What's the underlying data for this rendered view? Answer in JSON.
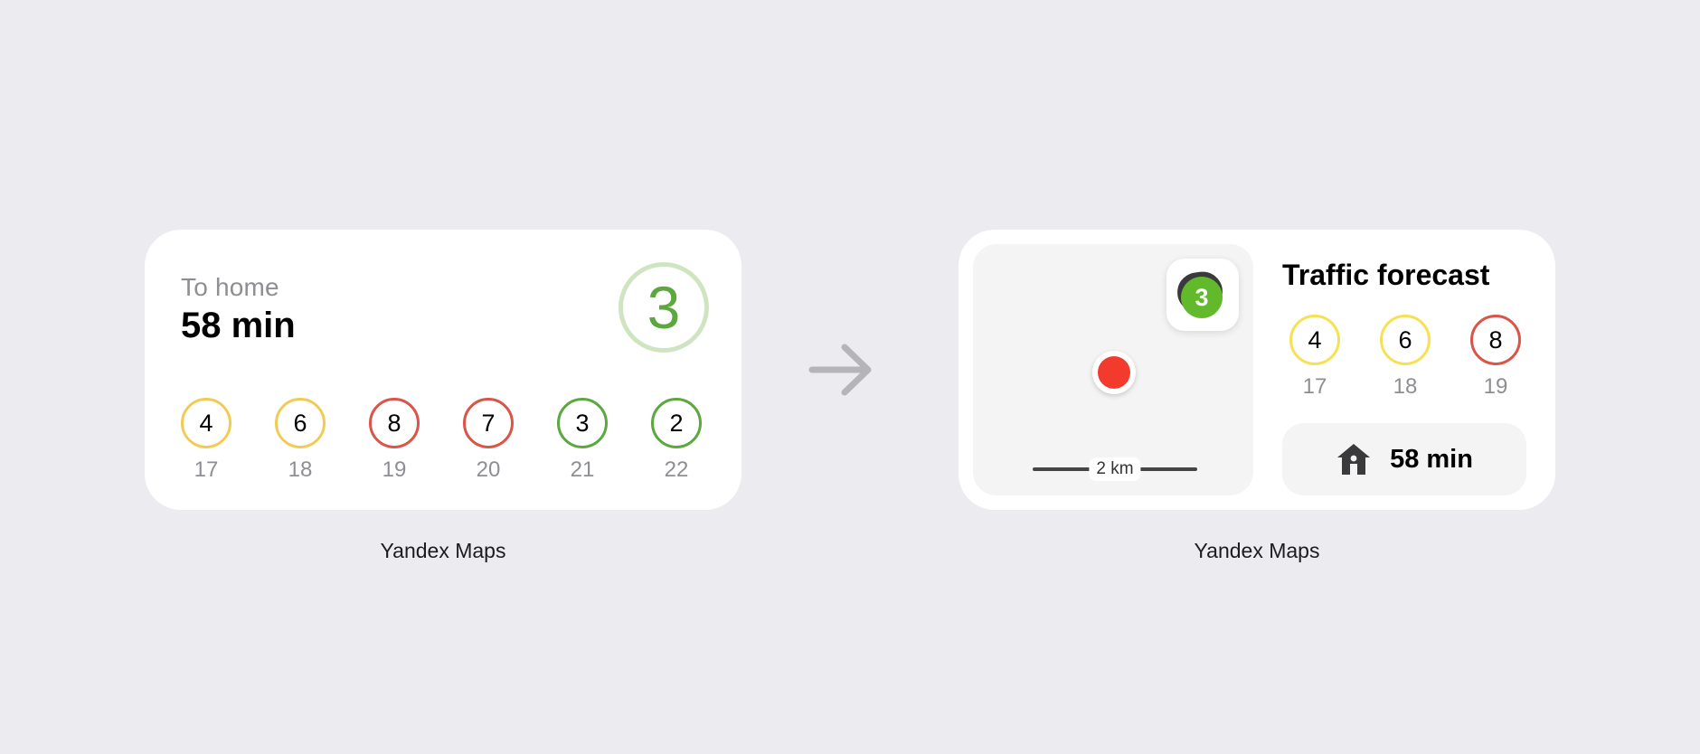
{
  "colors": {
    "background": "#EBEBF0",
    "card": "#FFFFFF",
    "yellow": "#F1CB56",
    "light_yellow": "#F6E154",
    "red": "#DA5447",
    "green": "#5AA83E",
    "secondary_text": "#8E8E93"
  },
  "small_widget": {
    "label": "To home",
    "time": "58 min",
    "score": "3",
    "forecast": [
      {
        "level": "4",
        "hour": "17",
        "color": "#F1CB56"
      },
      {
        "level": "6",
        "hour": "18",
        "color": "#F1CB56"
      },
      {
        "level": "8",
        "hour": "19",
        "color": "#DA5447"
      },
      {
        "level": "7",
        "hour": "20",
        "color": "#DA5447"
      },
      {
        "level": "3",
        "hour": "21",
        "color": "#5AA83E"
      },
      {
        "level": "2",
        "hour": "22",
        "color": "#5AA83E"
      }
    ],
    "caption": "Yandex Maps"
  },
  "arrow": {
    "icon": "arrow-right-icon"
  },
  "medium_widget": {
    "badge_score": "3",
    "scale": "2 km",
    "title": "Traffic forecast",
    "forecast": [
      {
        "level": "4",
        "hour": "17",
        "color": "#F6E154"
      },
      {
        "level": "6",
        "hour": "18",
        "color": "#F6E154"
      },
      {
        "level": "8",
        "hour": "19",
        "color": "#DA5447"
      }
    ],
    "home_icon": "house-icon",
    "home_time": "58 min",
    "caption": "Yandex Maps"
  }
}
